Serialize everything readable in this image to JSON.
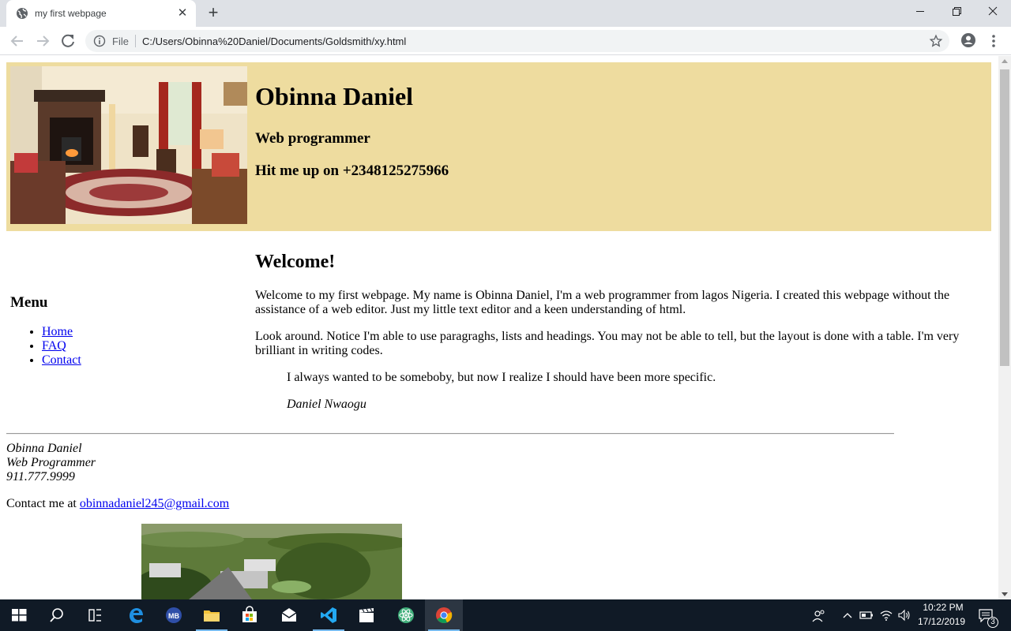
{
  "browser": {
    "tab_title": "my first webpage",
    "file_label": "File",
    "url": "C:/Users/Obinna%20Daniel/Documents/Goldsmith/xy.html"
  },
  "page": {
    "header": {
      "name": "Obinna Daniel",
      "role": "Web programmer",
      "phone_line": "Hit me up on +2348125275966",
      "background_color": "#eedc9f"
    },
    "menu": {
      "heading": "Menu",
      "items": [
        {
          "label": "Home"
        },
        {
          "label": "FAQ"
        },
        {
          "label": "Contact"
        }
      ]
    },
    "main": {
      "heading": "Welcome!",
      "paragraph1": "Welcome to my first webpage. My name is Obinna Daniel, I'm a web programmer from lagos Nigeria. I created this webpage without the assistance of a web editor. Just my little text editor and a keen understanding of html.",
      "paragraph2": "Look around. Notice I'm able to use paragraghs, lists and headings. You may not be able to tell, but the layout is done with a table. I'm very brilliant in writing codes.",
      "quote": "I always wanted to be someboby, but now I realize I should have been more specific.",
      "quote_author": "Daniel Nwaogu"
    },
    "address": {
      "name": "Obinna Daniel",
      "role": "Web Programmer",
      "phone": "911.777.9999"
    },
    "contact": {
      "prefix": "Contact me at ",
      "email": "obinnadaniel245@gmail.com"
    },
    "link_color": "#0000ee"
  },
  "taskbar": {
    "time": "10:22 PM",
    "date": "17/12/2019",
    "notification_count": "3",
    "icons": [
      "windows-start-icon",
      "search-icon",
      "task-view-icon",
      "edge-icon",
      "malwarebytes-icon",
      "file-explorer-icon",
      "store-icon",
      "mail-icon",
      "vscode-icon",
      "video-editor-icon",
      "atom-icon",
      "chrome-icon"
    ]
  }
}
